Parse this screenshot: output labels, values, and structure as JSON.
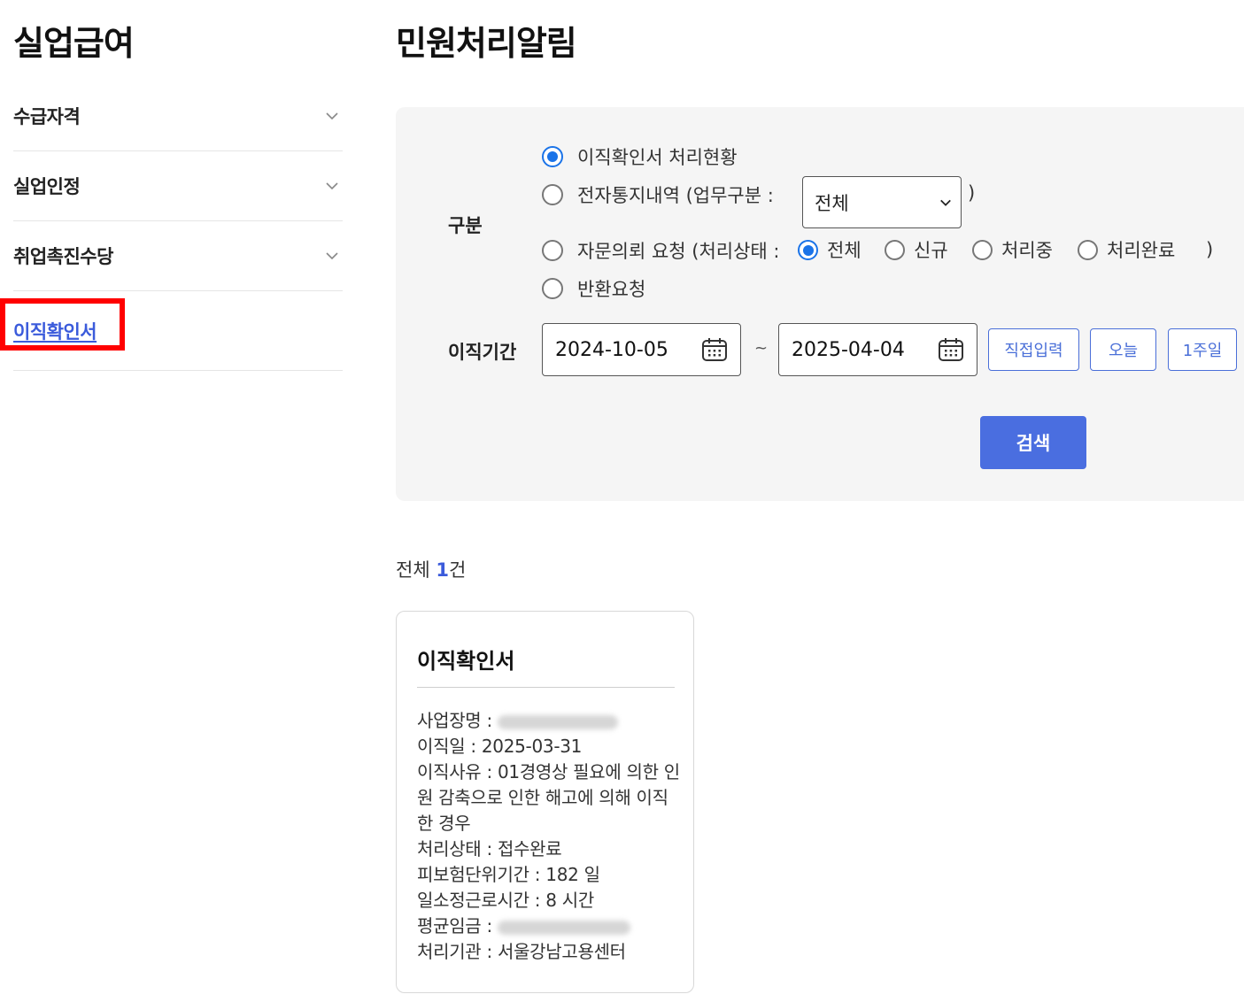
{
  "sidebar": {
    "title": "실업급여",
    "items": [
      {
        "label": "수급자격"
      },
      {
        "label": "실업인정"
      },
      {
        "label": "취업촉진수당"
      },
      {
        "label": "이직확인서"
      }
    ]
  },
  "main": {
    "title": "민원처리알림",
    "search": {
      "category_label": "구분",
      "options": {
        "opt1": "이직확인서 처리현황",
        "opt2": "전자통지내역 (업무구분 :",
        "opt2_close": ")",
        "opt3": "자문의뢰 요청 (처리상태 :",
        "opt3_close": ")",
        "opt4": "반환요청"
      },
      "select_value": "전체",
      "status_options": [
        "전체",
        "신규",
        "처리중",
        "처리완료"
      ],
      "period_label": "이직기간",
      "start_date": "2024-10-05",
      "tilde": "~",
      "end_date": "2025-04-04",
      "btn_direct": "직접입력",
      "btn_today": "오늘",
      "btn_week": "1주일",
      "btn_search": "검색"
    },
    "result": {
      "prefix": "전체 ",
      "count": "1",
      "suffix": "건"
    },
    "card": {
      "title": "이직확인서",
      "business_label": "사업장명 :",
      "leave_date_label": "이직일 :",
      "leave_date": "2025-03-31",
      "reason_label": "이직사유 :",
      "reason": "01경영상 필요에 의한 인원 감축으로 인한 해고에 의해 이직한 경우",
      "status_label": "처리상태 :",
      "status": "접수완료",
      "insured_period_label": "피보험단위기간 :",
      "insured_period": "182 일",
      "work_hours_label": "일소정근로시간 :",
      "work_hours": "8 시간",
      "avg_wage_label": "평균임금 :",
      "agency_label": "처리기관 :",
      "agency": "서울강남고용센터"
    }
  },
  "colors": {
    "accent": "#4a6ee0",
    "radio_checked": "#1a73e8",
    "highlight": "#ff0000"
  }
}
